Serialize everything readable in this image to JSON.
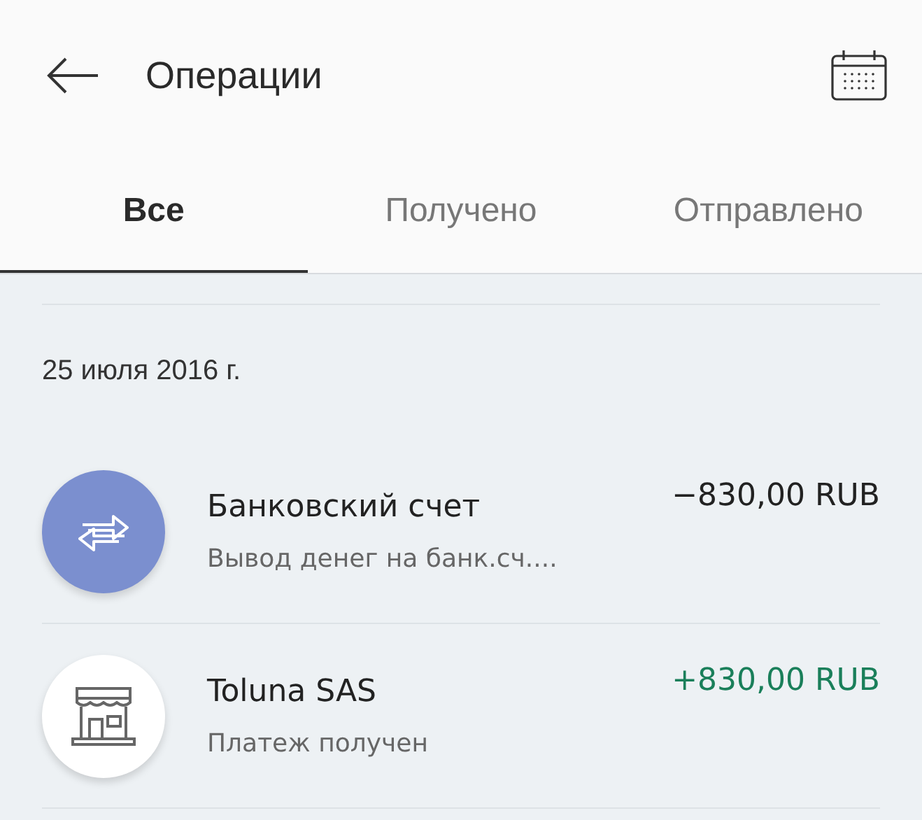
{
  "header": {
    "title": "Операции"
  },
  "tabs": [
    {
      "label": "Все",
      "selected": true
    },
    {
      "label": "Получено",
      "selected": false
    },
    {
      "label": "Отправлено",
      "selected": false
    }
  ],
  "date": "25 июля 2016 г.",
  "transactions": [
    {
      "kind": "transfer",
      "title": "Банковский счет",
      "subtitle": "Вывод денег на банк.сч....",
      "amount": "−830,00 RUB",
      "incoming": false
    },
    {
      "kind": "shop",
      "title": "Toluna SAS",
      "subtitle": "Платеж получен",
      "amount": "+830,00 RUB",
      "incoming": true
    }
  ]
}
